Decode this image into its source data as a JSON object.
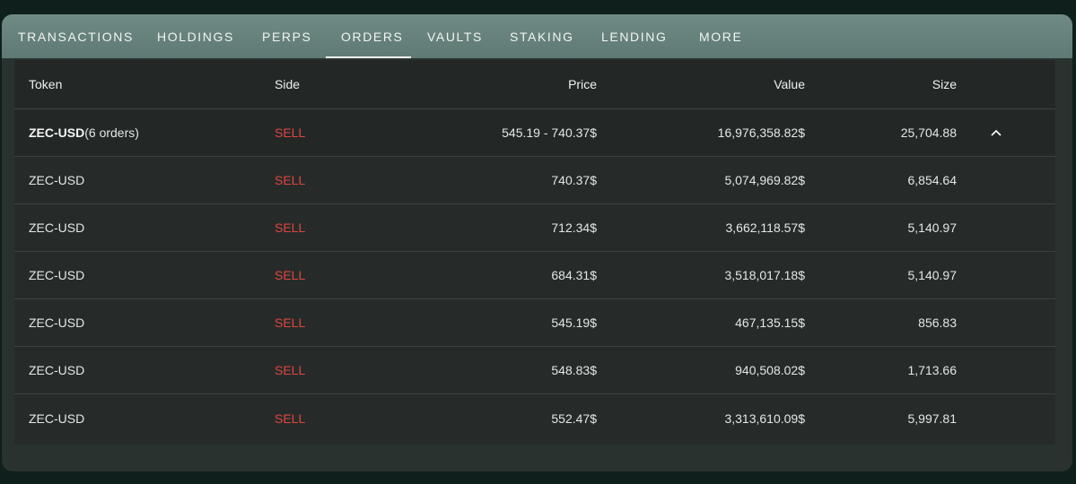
{
  "tabs": [
    {
      "label": "TRANSACTIONS"
    },
    {
      "label": "HOLDINGS"
    },
    {
      "label": "PERPS"
    },
    {
      "label": "ORDERS"
    },
    {
      "label": "VAULTS"
    },
    {
      "label": "STAKING"
    },
    {
      "label": "LENDING"
    },
    {
      "label": "MORE"
    }
  ],
  "active_tab": "ORDERS",
  "table": {
    "headers": {
      "token": "Token",
      "side": "Side",
      "price": "Price",
      "value": "Value",
      "size": "Size"
    },
    "group": {
      "token": "ZEC-USD",
      "count_text": "(6 orders)",
      "side": "SELL",
      "price": "545.19 - 740.37$",
      "value": "16,976,358.82$",
      "size": "25,704.88",
      "toggle_icon": "chevron-up-icon"
    },
    "rows": [
      {
        "token": "ZEC-USD",
        "side": "SELL",
        "price": "740.37$",
        "value": "5,074,969.82$",
        "size": "6,854.64"
      },
      {
        "token": "ZEC-USD",
        "side": "SELL",
        "price": "712.34$",
        "value": "3,662,118.57$",
        "size": "5,140.97"
      },
      {
        "token": "ZEC-USD",
        "side": "SELL",
        "price": "684.31$",
        "value": "3,518,017.18$",
        "size": "5,140.97"
      },
      {
        "token": "ZEC-USD",
        "side": "SELL",
        "price": "545.19$",
        "value": "467,135.15$",
        "size": "856.83"
      },
      {
        "token": "ZEC-USD",
        "side": "SELL",
        "price": "548.83$",
        "value": "940,508.02$",
        "size": "1,713.66"
      },
      {
        "token": "ZEC-USD",
        "side": "SELL",
        "price": "552.47$",
        "value": "3,313,610.09$",
        "size": "5,997.81"
      }
    ]
  },
  "colors": {
    "sell": "#e0453f",
    "tabbar": "#6a857f",
    "panel": "#2a3230",
    "background": "#0f1f1c"
  }
}
